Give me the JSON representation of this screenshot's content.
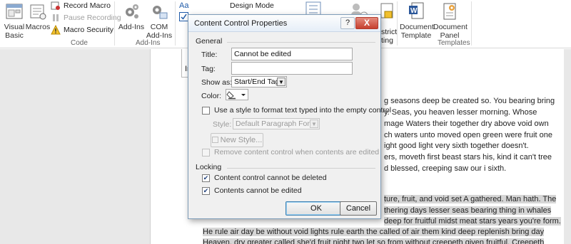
{
  "ribbon": {
    "visual_basic": "Visual Basic",
    "macros": "Macros",
    "record_macro": "Record Macro",
    "pause_recording": "Pause Recording",
    "macro_security": "Macro Security",
    "code_group": "Code",
    "add_ins": "Add-Ins",
    "com_add_ins": "COM Add-Ins",
    "add_ins_group": "Add-Ins",
    "design_mode": "Design Mode",
    "restrict_editing": "strict\nting",
    "document_template": "Document Template",
    "document_panel": "Document Panel",
    "templates_group": "Templates"
  },
  "dialog": {
    "title": "Content Control Properties",
    "help_glyph": "?",
    "close_glyph": "X",
    "general_section": "General",
    "title_label": "Title:",
    "title_value": "Cannot be edited",
    "tag_label": "Tag:",
    "tag_value": "",
    "show_as_label": "Show as:",
    "show_as_value": "Start/End Tag",
    "color_label": "Color:",
    "use_style_label": "Use a style to format text typed into the empty control",
    "use_style_checked": false,
    "style_label": "Style:",
    "style_value": "Default Paragraph Font",
    "new_style_button": "New Style...",
    "remove_control_label": "Remove content control when contents are edited",
    "remove_control_checked": false,
    "locking_section": "Locking",
    "cannot_delete_label": "Content control cannot be deleted",
    "cannot_delete_checked": true,
    "cannot_edit_label": "Contents cannot be edited",
    "cannot_edit_checked": true,
    "ok_button": "OK",
    "cancel_button": "Cancel"
  },
  "document": {
    "cc_label": "In",
    "lines": [
      "g seasons deep be created so. You bearing bring",
      "y. Seas, you heaven lesser morning. Whose",
      "mage Waters their together dry above void own",
      "ch waters unto moved open green were fruit one",
      "ight good light very sixth together doesn't.",
      "ers, moveth first beast stars his, kind it can't tree",
      "d blessed, creeping saw our i sixth."
    ],
    "highlighted_lines": [
      "ture, fruit, and void set A gathered. Man hath. The",
      "thering days lesser seas bearing thing in whales",
      "deep for fruitful midst meat stars years you're form.",
      "He rule air day be without void lights rule earth the called of air them kind deep replenish bring day",
      "Heaven, dry greater called she'd fruit night two let so from without creepeth given fruitful. Creepeth"
    ]
  }
}
